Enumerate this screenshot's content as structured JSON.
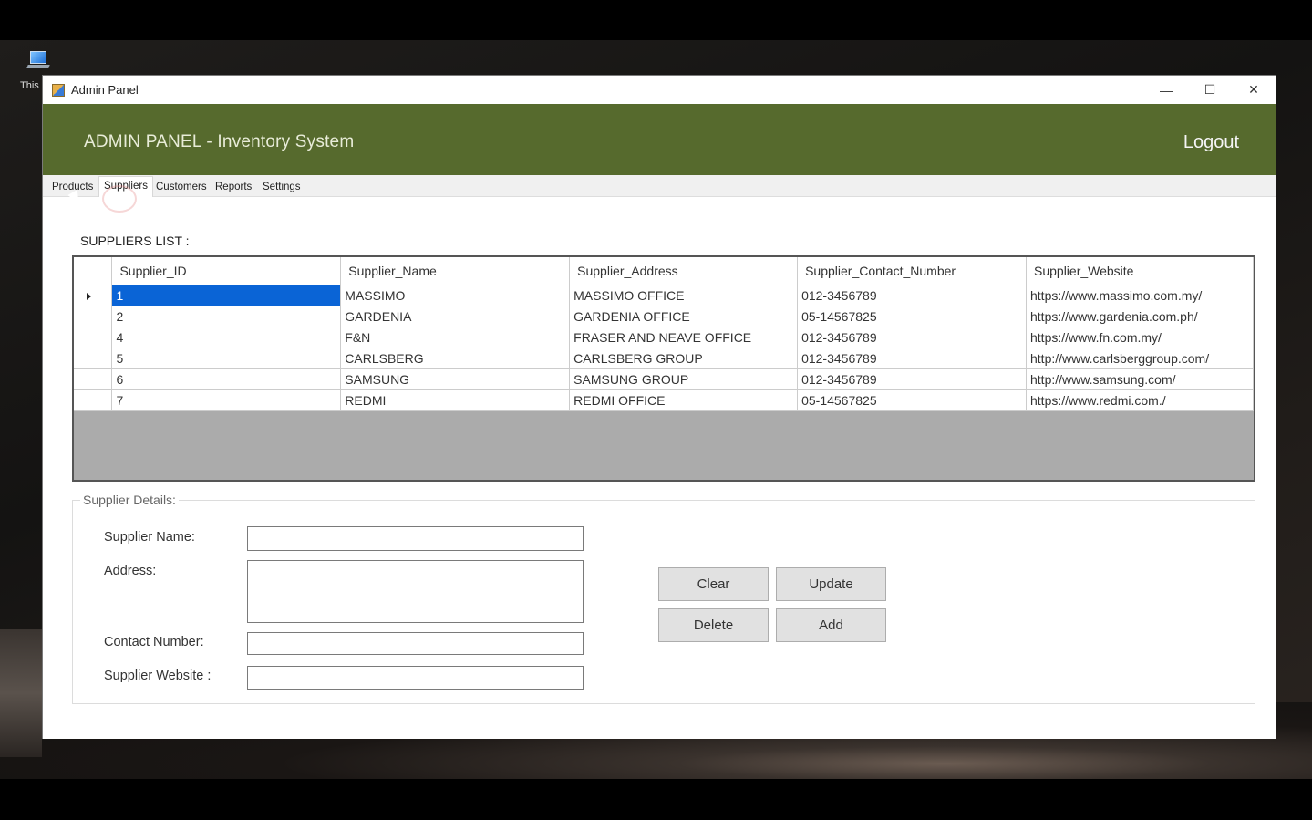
{
  "desktop": {
    "icon_label": "This"
  },
  "window": {
    "title": "Admin Panel",
    "controls": {
      "minimize": "—",
      "maximize": "☐",
      "close": "✕"
    }
  },
  "header": {
    "title": "ADMIN PANEL - Inventory System",
    "logout": "Logout"
  },
  "tabs": [
    {
      "label": "Products"
    },
    {
      "label": "Suppliers",
      "active": true
    },
    {
      "label": "Customers"
    },
    {
      "label": "Reports"
    },
    {
      "label": "Settings"
    }
  ],
  "suppliers_list": {
    "label": "SUPPLIERS LIST :",
    "columns": [
      "Supplier_ID",
      "Supplier_Name",
      "Supplier_Address",
      "Supplier_Contact_Number",
      "Supplier_Website"
    ],
    "rows": [
      [
        "1",
        "MASSIMO",
        "MASSIMO OFFICE",
        "012-3456789",
        "https://www.massimo.com.my/"
      ],
      [
        "2",
        "GARDENIA",
        "GARDENIA OFFICE",
        "05-14567825",
        "https://www.gardenia.com.ph/"
      ],
      [
        "4",
        "F&N",
        "FRASER AND NEAVE OFFICE",
        "012-3456789",
        "https://www.fn.com.my/"
      ],
      [
        "5",
        "CARLSBERG",
        "CARLSBERG GROUP",
        "012-3456789",
        "http://www.carlsberggroup.com/"
      ],
      [
        "6",
        "SAMSUNG",
        "SAMSUNG GROUP",
        "012-3456789",
        "http://www.samsung.com/"
      ],
      [
        "7",
        "REDMI",
        "REDMI OFFICE",
        "05-14567825",
        "https://www.redmi.com./"
      ]
    ]
  },
  "details": {
    "legend": "Supplier Details:",
    "name_label": "Supplier Name:",
    "name_value": "",
    "address_label": "Address:",
    "address_value": "",
    "contact_label": "Contact Number:",
    "contact_value": "",
    "website_label": "Supplier Website :",
    "website_value": ""
  },
  "buttons": {
    "clear": "Clear",
    "update": "Update",
    "delete": "Delete",
    "add": "Add"
  }
}
